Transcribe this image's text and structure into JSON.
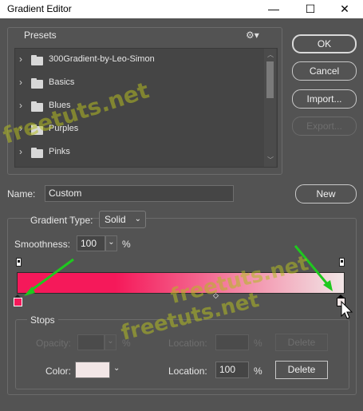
{
  "window": {
    "title": "Gradient Editor",
    "minimize_icon": "—",
    "maximize_icon": "☐",
    "close_icon": "✕"
  },
  "presets": {
    "label": "Presets",
    "items": [
      {
        "label": "300Gradient-by-Leo-Simon"
      },
      {
        "label": "Basics"
      },
      {
        "label": "Blues"
      },
      {
        "label": "Purples"
      },
      {
        "label": "Pinks"
      }
    ]
  },
  "buttons": {
    "ok": "OK",
    "cancel": "Cancel",
    "import": "Import...",
    "export": "Export...",
    "new": "New"
  },
  "name_field": {
    "label": "Name:",
    "value": "Custom"
  },
  "gradient": {
    "type_label": "Gradient Type:",
    "type_value": "Solid",
    "smoothness_label": "Smoothness:",
    "smoothness_value": "100",
    "smoothness_unit": "%",
    "color_start": "#f5195a",
    "color_end": "#f2e6e6"
  },
  "stops": {
    "label": "Stops",
    "opacity_label": "Opacity:",
    "opacity_unit": "%",
    "opacity_location_label": "Location:",
    "opacity_location_unit": "%",
    "opacity_delete": "Delete",
    "color_label": "Color:",
    "color_swatch": "#f2e6e6",
    "color_location_label": "Location:",
    "color_location_value": "100",
    "color_location_unit": "%",
    "color_delete": "Delete"
  },
  "watermark": {
    "text": "freetuts.net"
  }
}
